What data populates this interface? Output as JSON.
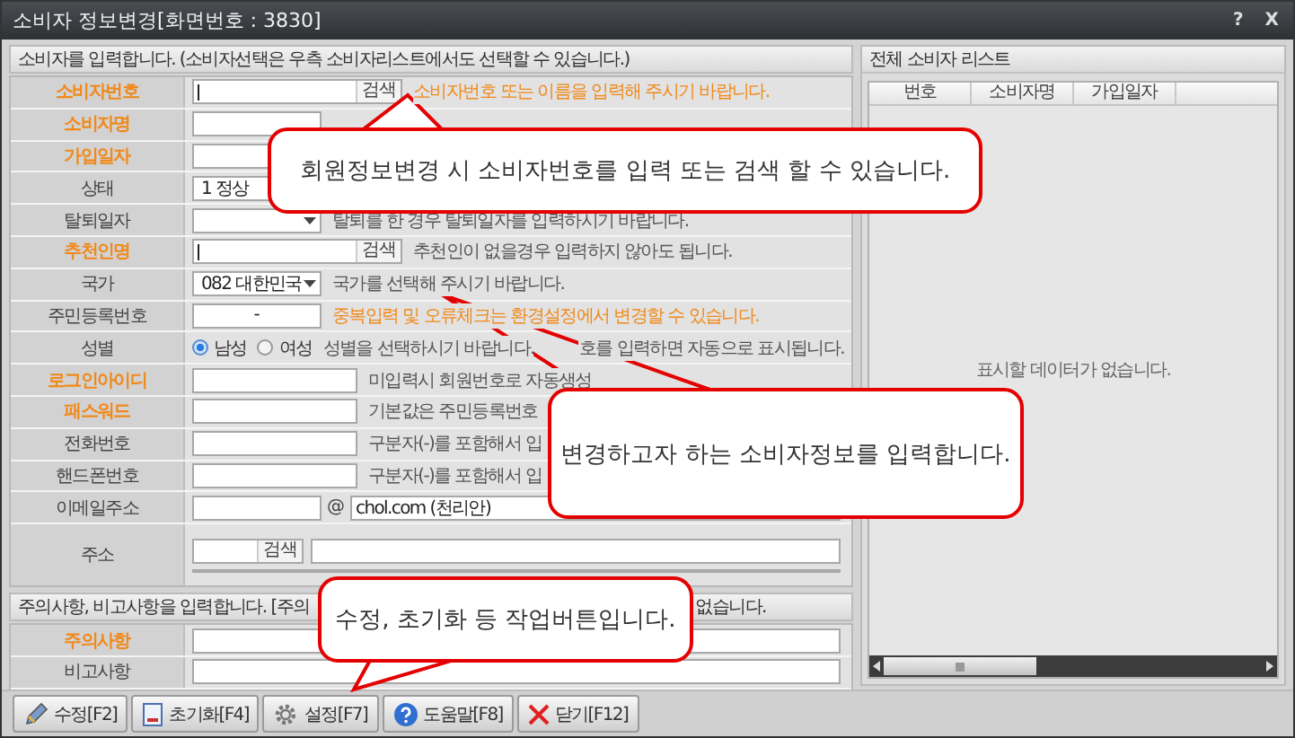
{
  "window": {
    "title": "소비자 정보변경[화면번호 : 3830]",
    "controls": [
      "?",
      "X"
    ]
  },
  "form": {
    "header": "소비자를 입력합니다. (소비자선택은 우측 소비자리스트에서도 선택할 수 있습니다.)",
    "rows": [
      {
        "label": "소비자번호",
        "required": true,
        "kind": "search",
        "button": "검색",
        "hint": "소비자번호 또는 이름을 입력해 주시기 바랍니다.",
        "hint_emphasis": true
      },
      {
        "label": "소비자명",
        "required": true,
        "kind": "text"
      },
      {
        "label": "가입일자",
        "required": true,
        "kind": "text"
      },
      {
        "label": "상태",
        "required": false,
        "kind": "select",
        "value": "1 정상"
      },
      {
        "label": "탈퇴일자",
        "required": false,
        "kind": "select",
        "hint": "탈퇴를 한 경우 탈퇴일자를 입력하시기 바랍니다.",
        "hint_emphasis": false
      },
      {
        "label": "추천인명",
        "required": true,
        "kind": "search",
        "button": "검색",
        "hint": "추천인이 없을경우 입력하지 않아도 됩니다.",
        "hint_emphasis": false
      },
      {
        "label": "국가",
        "required": false,
        "kind": "select",
        "value": "082 대한민국",
        "hint": "국가를 선택해 주시기 바랍니다.",
        "hint_emphasis": false
      },
      {
        "label": "주민등록번호",
        "required": false,
        "kind": "text",
        "value": "-",
        "hint": "중복입력 및 오류체크는 환경설정에서 변경할 수 있습니다.",
        "hint_emphasis": true
      },
      {
        "label": "성별",
        "required": false,
        "kind": "radio",
        "options": [
          {
            "label": "남성",
            "selected": true
          },
          {
            "label": "여성",
            "selected": false
          }
        ],
        "hint": "성별을 선택하시기 바랍니다.",
        "hint_tail": "호를 입력하면 자동으로 표시됩니다.",
        "hint_emphasis": false
      },
      {
        "label": "로그인아이디",
        "required": true,
        "kind": "long",
        "hint": "미입력시 회원번호로 자동생성",
        "hint_emphasis": false
      },
      {
        "label": "패스워드",
        "required": true,
        "kind": "long",
        "hint": "기본값은 주민등록번호",
        "hint_emphasis": false
      },
      {
        "label": "전화번호",
        "required": false,
        "kind": "long",
        "hint": "구분자(-)를 포함해서 입",
        "hint_emphasis": false
      },
      {
        "label": "핸드폰번호",
        "required": false,
        "kind": "long",
        "hint": "구분자(-)를 포함해서 입",
        "hint_emphasis": false
      },
      {
        "label": "이메일주소",
        "required": false,
        "kind": "email",
        "separator": "@",
        "value": "chol.com (천리안)"
      },
      {
        "label": "주소",
        "required": false,
        "kind": "address",
        "button": "검색"
      }
    ]
  },
  "notes": {
    "header": "주의사항, 비고사항을 입력합니다. [주의",
    "header_tail": "없습니다.",
    "rows": [
      {
        "label": "주의사항",
        "required": true
      },
      {
        "label": "비고사항",
        "required": false
      }
    ]
  },
  "toolbar": {
    "buttons": [
      "수정[F2]",
      "초기화[F4]",
      "설정[F7]",
      "도움말[F8]",
      "닫기[F12]"
    ]
  },
  "customer_list": {
    "title": "전체 소비자 리스트",
    "columns": [
      "번호",
      "소비자명",
      "가입일자"
    ],
    "empty_message": "표시할 데이터가 없습니다."
  },
  "callouts": [
    {
      "text": "회원정보변경 시  소비자번호를 입력 또는 검색 할 수 있습니다."
    },
    {
      "text": "변경하고자 하는 소비자정보를 입력합니다."
    },
    {
      "text": "수정, 초기화 등 작업버튼입니다."
    }
  ]
}
